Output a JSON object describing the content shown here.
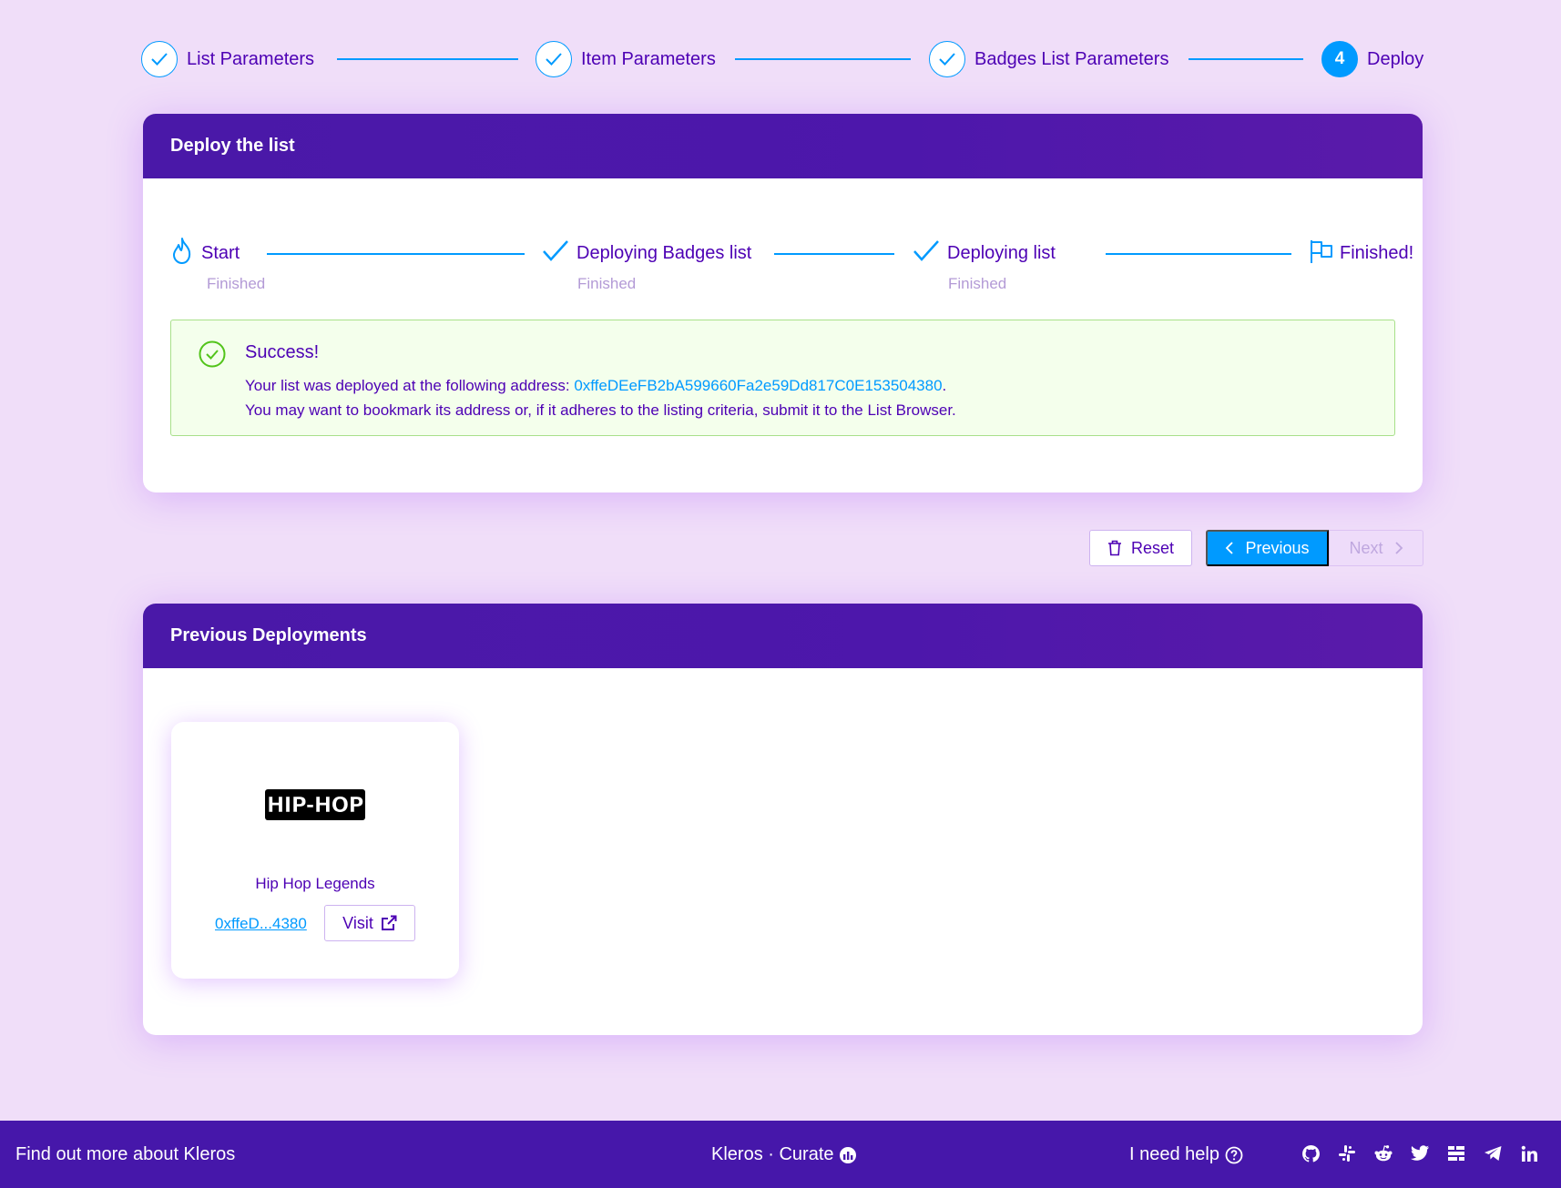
{
  "steps": [
    {
      "label": "List Parameters",
      "state": "done"
    },
    {
      "label": "Item Parameters",
      "state": "done"
    },
    {
      "label": "Badges List Parameters",
      "state": "done"
    },
    {
      "label": "Deploy",
      "state": "active",
      "number": "4"
    }
  ],
  "deploy_card": {
    "title": "Deploy the list",
    "steps": [
      {
        "label": "Start",
        "desc": "Finished",
        "icon": "fire-icon"
      },
      {
        "label": "Deploying Badges list",
        "desc": "Finished",
        "icon": "check-icon"
      },
      {
        "label": "Deploying list",
        "desc": "Finished",
        "icon": "check-icon"
      },
      {
        "label": "Finished!",
        "desc": "",
        "icon": "flag-icon"
      }
    ],
    "alert": {
      "title": "Success!",
      "line1_prefix": "Your list was deployed at the following address: ",
      "address": "0xffeDEeFB2bA599660Fa2e59Dd817C0E153504380",
      "line1_suffix": ".",
      "line2": "You may want to bookmark its address or, if it adheres to the listing criteria, submit it to the List Browser."
    }
  },
  "buttons": {
    "reset": "Reset",
    "previous": "Previous",
    "next": "Next"
  },
  "deployments_card": {
    "title": "Previous Deployments",
    "items": [
      {
        "name": "Hip Hop Legends",
        "short_address": "0xffeD...4380",
        "visit_label": "Visit",
        "logo_text": "HIP-HOP"
      }
    ]
  },
  "footer": {
    "left": "Find out more about Kleros",
    "center": "Kleros · Curate",
    "help": "I need help",
    "social": [
      "github-icon",
      "slack-icon",
      "reddit-icon",
      "twitter-icon",
      "blog-icon",
      "telegram-icon",
      "linkedin-icon"
    ]
  },
  "colors": {
    "background": "#f0def9",
    "primary": "#4d00b4",
    "accent": "#009aff",
    "header": "#4617aa",
    "success_bg": "#f4ffec"
  }
}
